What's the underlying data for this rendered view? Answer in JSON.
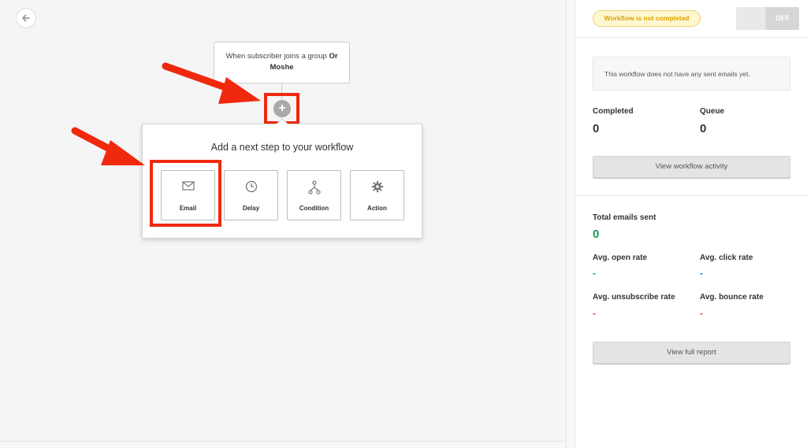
{
  "canvas": {
    "trigger": {
      "prefix": "When subscriber joins a group",
      "group_name": "Or Moshe"
    },
    "add_button": {
      "symbol": "+"
    },
    "popup": {
      "title": "Add a next step to your workflow",
      "steps": [
        {
          "label": "Email",
          "icon": "envelope-icon"
        },
        {
          "label": "Delay",
          "icon": "clock-icon"
        },
        {
          "label": "Condition",
          "icon": "branch-icon"
        },
        {
          "label": "Action",
          "icon": "gear-icon"
        }
      ]
    },
    "annotation_color": "#f0290e"
  },
  "sidebar": {
    "status_badge": "Workflow is not completed",
    "toggle": {
      "state": "OFF"
    },
    "info_message": "This workflow does not have any sent emails yet.",
    "completed": {
      "label": "Completed",
      "value": "0"
    },
    "queue": {
      "label": "Queue",
      "value": "0"
    },
    "view_activity_button": "View workflow activity",
    "total_sent": {
      "label": "Total emails sent",
      "value": "0",
      "color": "#1a9a5c"
    },
    "open_rate": {
      "label": "Avg. open rate",
      "value": "-",
      "color": "#1a9a5c"
    },
    "click_rate": {
      "label": "Avg. click rate",
      "value": "-",
      "color": "#2a7fc6"
    },
    "unsubscribe_rate": {
      "label": "Avg. unsubscribe rate",
      "value": "-",
      "color": "#e0542d"
    },
    "bounce_rate": {
      "label": "Avg. bounce rate",
      "value": "-",
      "color": "#e0542d"
    },
    "full_report_button": "View full report"
  }
}
